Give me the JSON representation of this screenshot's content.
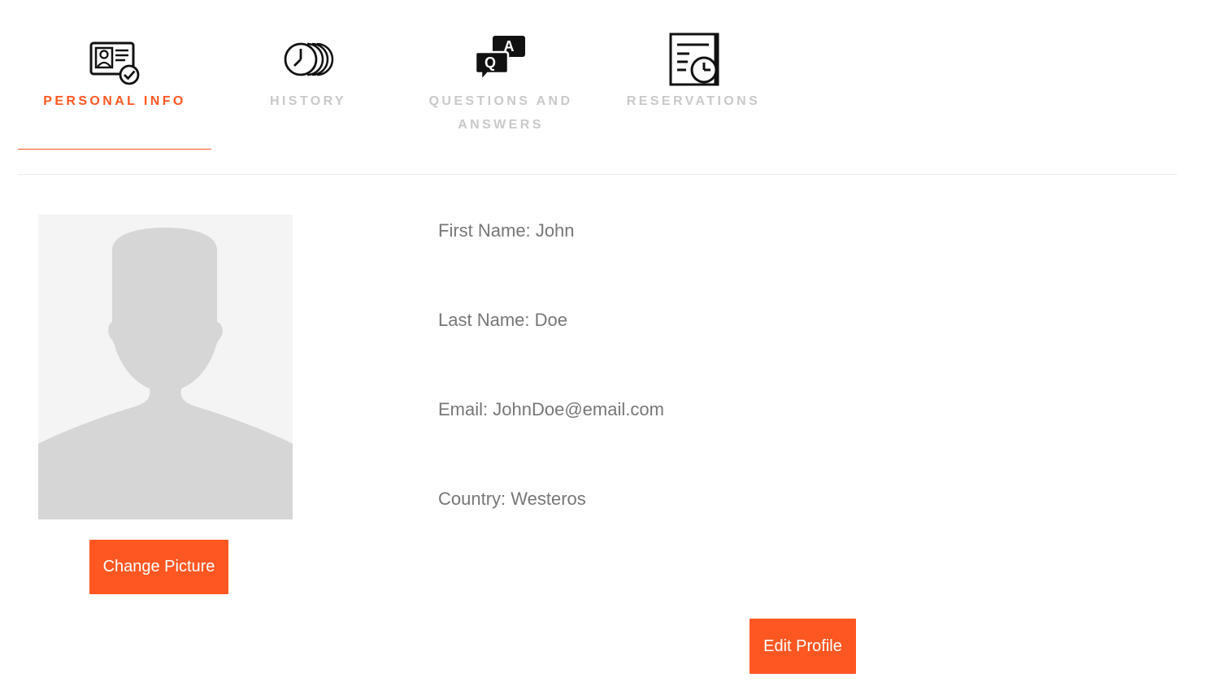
{
  "tabs": [
    {
      "label": "PERSONAL INFO",
      "icon": "id-card-check-icon",
      "active": true
    },
    {
      "label": "HISTORY",
      "icon": "history-clocks-icon",
      "active": false
    },
    {
      "label": "QUESTIONS AND ANSWERS",
      "icon": "qa-chat-bubbles-icon",
      "active": false
    },
    {
      "label": "RESERVATIONS",
      "icon": "document-clock-icon",
      "active": false
    }
  ],
  "profile": {
    "first_name_label": "First Name:",
    "first_name": "John",
    "last_name_label": "Last Name:",
    "last_name": "Doe",
    "email_label": "Email:",
    "email": "JohnDoe@email.com",
    "country_label": "Country:",
    "country": "Westeros"
  },
  "buttons": {
    "change_picture": "Change Picture",
    "edit_profile": "Edit Profile"
  },
  "colors": {
    "accent": "#ff5722",
    "inactive_tab": "#c9c9c9",
    "text": "#777777",
    "avatar_bg": "#f4f4f4",
    "avatar_silhouette": "#d6d6d6"
  }
}
